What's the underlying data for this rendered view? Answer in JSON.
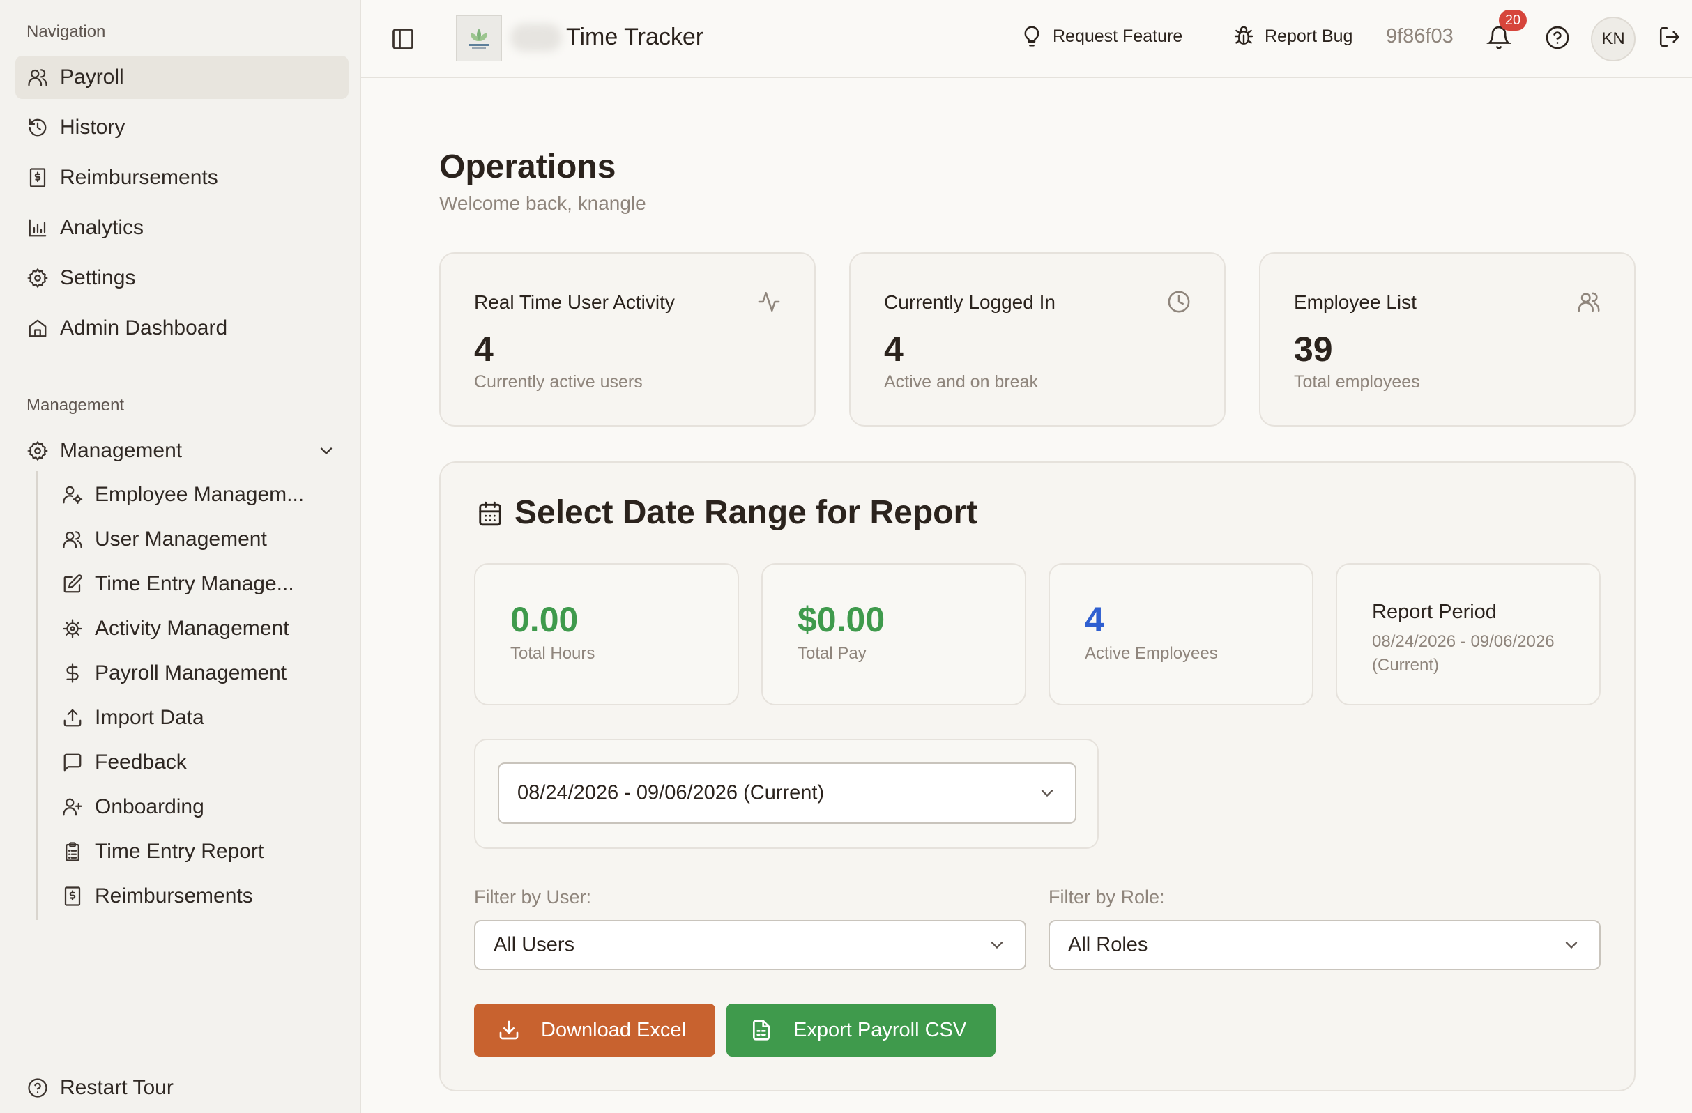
{
  "sidebar": {
    "nav_title": "Navigation",
    "items": [
      {
        "label": "Payroll",
        "icon": "users-icon"
      },
      {
        "label": "History",
        "icon": "history-icon"
      },
      {
        "label": "Reimbursements",
        "icon": "receipt-icon"
      },
      {
        "label": "Analytics",
        "icon": "bar-chart-icon"
      },
      {
        "label": "Settings",
        "icon": "gear-icon"
      },
      {
        "label": "Admin Dashboard",
        "icon": "home-icon"
      }
    ],
    "management_title": "Management",
    "management_group": {
      "label": "Management",
      "icon": "gear-icon"
    },
    "sub_items": [
      {
        "label": "Employee Managem...",
        "icon": "user-cog-icon"
      },
      {
        "label": "User Management",
        "icon": "users-icon"
      },
      {
        "label": "Time Entry Manage...",
        "icon": "edit-icon"
      },
      {
        "label": "Activity Management",
        "icon": "cog-icon"
      },
      {
        "label": "Payroll Management",
        "icon": "dollar-icon"
      },
      {
        "label": "Import Data",
        "icon": "upload-icon"
      },
      {
        "label": "Feedback",
        "icon": "message-icon"
      },
      {
        "label": "Onboarding",
        "icon": "user-plus-icon"
      },
      {
        "label": "Time Entry Report",
        "icon": "clipboard-icon"
      },
      {
        "label": "Reimbursements",
        "icon": "receipt-icon"
      }
    ],
    "restart_tour": "Restart Tour"
  },
  "header": {
    "title": "Time Tracker",
    "request_feature": "Request Feature",
    "report_bug": "Report Bug",
    "version": "9f86f03",
    "notification_count": "20",
    "avatar_initials": "KN"
  },
  "main": {
    "title": "Operations",
    "subtitle": "Welcome back, knangle",
    "stats": [
      {
        "title": "Real Time User Activity",
        "value": "4",
        "desc": "Currently active users",
        "icon": "activity-icon"
      },
      {
        "title": "Currently Logged In",
        "value": "4",
        "desc": "Active and on break",
        "icon": "clock-icon"
      },
      {
        "title": "Employee List",
        "value": "39",
        "desc": "Total employees",
        "icon": "users-icon"
      }
    ],
    "report": {
      "title": "Select Date Range for Report",
      "total_hours": "0.00",
      "total_hours_label": "Total Hours",
      "total_pay": "$0.00",
      "total_pay_label": "Total Pay",
      "active_employees": "4",
      "active_employees_label": "Active Employees",
      "period_title": "Report Period",
      "period_value": "08/24/2026 - 09/06/2026 (Current)",
      "date_range_selected": "08/24/2026 - 09/06/2026 (Current)",
      "filter_user_label": "Filter by User:",
      "filter_user_value": "All Users",
      "filter_role_label": "Filter by Role:",
      "filter_role_value": "All Roles",
      "download_excel": "Download Excel",
      "export_csv": "Export Payroll CSV"
    }
  },
  "colors": {
    "accent_green": "#3f9a4c",
    "accent_blue": "#2f5fd0",
    "accent_orange": "#c8622f",
    "badge_red": "#d6453b"
  }
}
